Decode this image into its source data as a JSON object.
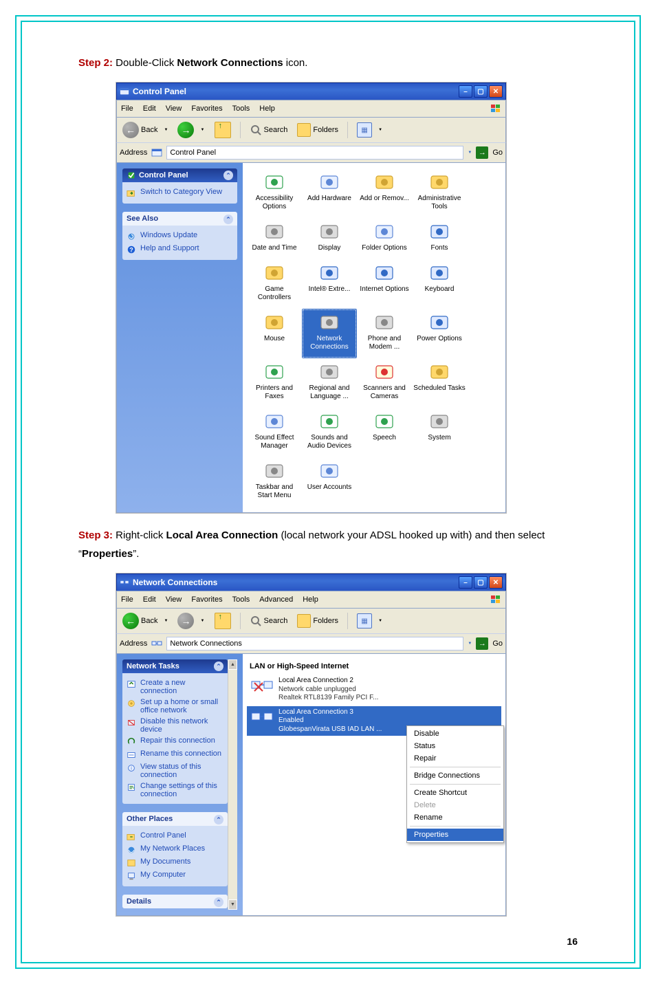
{
  "page_number": "16",
  "step2": {
    "label": "Step 2:",
    "text_before": " Double-Click ",
    "bold": "Network Connections",
    "text_after": " icon."
  },
  "step3": {
    "label": "Step 3:",
    "t1": " Right-click ",
    "b1": "Local Area Connection",
    "t2": " (local network your ADSL hooked up with) and then select “",
    "b2": "Properties",
    "t3": "”."
  },
  "win1": {
    "title": "Control Panel",
    "menus": [
      "File",
      "Edit",
      "View",
      "Favorites",
      "Tools",
      "Help"
    ],
    "toolbar": {
      "back": "Back",
      "search": "Search",
      "folders": "Folders"
    },
    "address_label": "Address",
    "address_value": "Control Panel",
    "go": "Go",
    "left": {
      "p1_head": "Control Panel",
      "p1_item": "Switch to Category View",
      "p2_head": "See Also",
      "p2_items": [
        "Windows Update",
        "Help and Support"
      ]
    },
    "icons": [
      {
        "l": "Accessibility Options"
      },
      {
        "l": "Add Hardware"
      },
      {
        "l": "Add or Remov..."
      },
      {
        "l": "Administrative Tools"
      },
      {
        "l": "Date and Time"
      },
      {
        "l": "Display"
      },
      {
        "l": "Folder Options"
      },
      {
        "l": "Fonts"
      },
      {
        "l": "Game Controllers"
      },
      {
        "l": "Intel® Extre..."
      },
      {
        "l": "Internet Options"
      },
      {
        "l": "Keyboard"
      },
      {
        "l": "Mouse"
      },
      {
        "l": "Network Connections",
        "sel": true
      },
      {
        "l": "Phone and Modem ..."
      },
      {
        "l": "Power Options"
      },
      {
        "l": "Printers and Faxes"
      },
      {
        "l": "Regional and Language ..."
      },
      {
        "l": "Scanners and Cameras"
      },
      {
        "l": "Scheduled Tasks"
      },
      {
        "l": "Sound Effect Manager"
      },
      {
        "l": "Sounds and Audio Devices"
      },
      {
        "l": "Speech"
      },
      {
        "l": "System"
      },
      {
        "l": "Taskbar and Start Menu"
      },
      {
        "l": "User Accounts"
      }
    ]
  },
  "win2": {
    "title": "Network Connections",
    "menus": [
      "File",
      "Edit",
      "View",
      "Favorites",
      "Tools",
      "Advanced",
      "Help"
    ],
    "toolbar": {
      "back": "Back",
      "search": "Search",
      "folders": "Folders"
    },
    "address_label": "Address",
    "address_value": "Network Connections",
    "go": "Go",
    "left": {
      "p1_head": "Network Tasks",
      "p1_items": [
        "Create a new connection",
        "Set up a home or small office network",
        "Disable this network device",
        "Repair this connection",
        "Rename this connection",
        "View status of this connection",
        "Change settings of this connection"
      ],
      "p2_head": "Other Places",
      "p2_items": [
        "Control Panel",
        "My Network Places",
        "My Documents",
        "My Computer"
      ],
      "p3_head": "Details"
    },
    "group": "LAN or High-Speed Internet",
    "conns": [
      {
        "t1": "Local Area Connection 2",
        "t2": "Network cable unplugged",
        "t3": "Realtek RTL8139 Family PCI F..."
      },
      {
        "t1": "Local Area Connection 3",
        "t2": "Enabled",
        "t3": "GlobespanVirata USB IAD LAN ...",
        "sel": true
      }
    ],
    "ctx": [
      "Disable",
      "Status",
      "Repair",
      "|",
      "Bridge Connections",
      "|",
      "Create Shortcut",
      "Delete",
      "Rename",
      "|",
      "Properties"
    ],
    "ctx_disabled": [
      "Delete"
    ],
    "ctx_selected": "Properties"
  }
}
